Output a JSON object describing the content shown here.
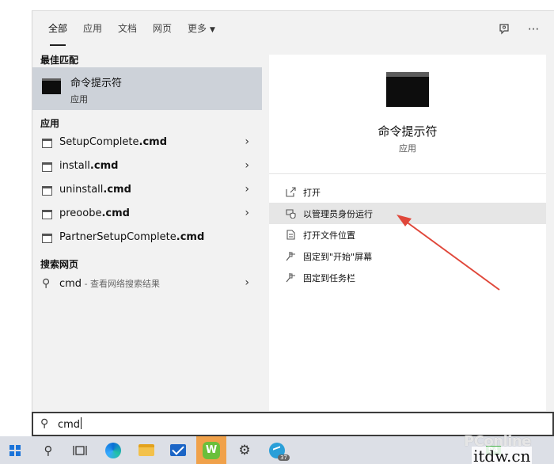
{
  "tabs": [
    {
      "label": "全部",
      "active": true
    },
    {
      "label": "应用",
      "active": false
    },
    {
      "label": "文档",
      "active": false
    },
    {
      "label": "网页",
      "active": false
    },
    {
      "label": "更多",
      "active": false
    }
  ],
  "top_icons": [
    "feedback-icon",
    "more-icon"
  ],
  "left": {
    "best_match_header": "最佳匹配",
    "best_match": {
      "name": "命令提示符",
      "type": "应用"
    },
    "apps_header": "应用",
    "apps": [
      {
        "name": "SetupComplete",
        "ext": ".cmd"
      },
      {
        "name": "install",
        "ext": ".cmd"
      },
      {
        "name": "uninstall",
        "ext": ".cmd"
      },
      {
        "name": "preoobe",
        "ext": ".cmd"
      },
      {
        "name": "PartnerSetupComplete",
        "ext": ".cmd"
      }
    ],
    "web_header": "搜索网页",
    "web": {
      "query": "cmd",
      "suffix": " - 查看网络搜索结果"
    }
  },
  "right": {
    "title": "命令提示符",
    "subtitle": "应用",
    "actions": [
      {
        "label": "打开",
        "icon": "open-icon",
        "highlighted": false
      },
      {
        "label": "以管理员身份运行",
        "icon": "shield-icon",
        "highlighted": true
      },
      {
        "label": "打开文件位置",
        "icon": "folder-location-icon",
        "highlighted": false
      },
      {
        "label": "固定到\"开始\"屏幕",
        "icon": "pin-icon",
        "highlighted": false
      },
      {
        "label": "固定到任务栏",
        "icon": "pin-icon",
        "highlighted": false
      }
    ],
    "annotation_color": "#e0473a"
  },
  "search": {
    "value": "cmd"
  },
  "taskbar": {
    "items": [
      "windows-start-icon",
      "search-icon",
      "task-view-icon",
      "edge-icon",
      "file-explorer-icon",
      "mail-icon",
      "wps-icon",
      "settings-icon",
      "telegram-icon"
    ],
    "wps_letter": "W",
    "telegram_badge": "37",
    "battery_text": "94",
    "accent": "#1a73d9"
  },
  "watermark": {
    "pconline": "PConline",
    "itdw": "itdw.cn"
  }
}
